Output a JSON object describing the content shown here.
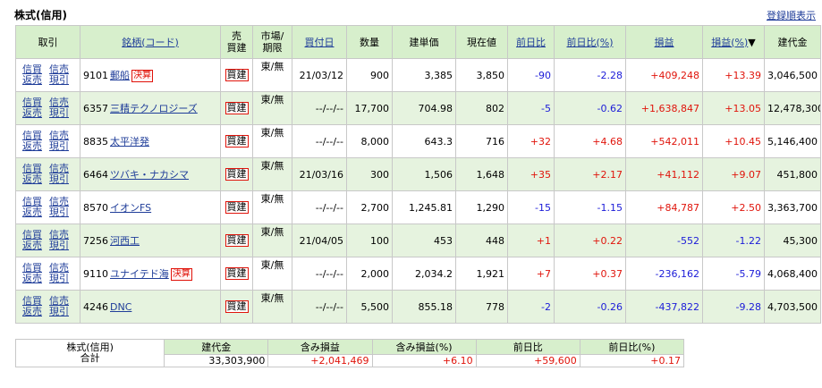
{
  "header": {
    "title": "株式(信用)",
    "sort_link": "登録順表示"
  },
  "columns": {
    "trade": "取引",
    "name_code": "銘柄(コード)",
    "sell_buy": "売\n買建",
    "market_term": "市場/\n期限",
    "date": "買付日",
    "qty": "数量",
    "price": "建単価",
    "current": "現在値",
    "day_change": "前日比",
    "day_change_pct": "前日比(%)",
    "pnl": "損益",
    "pnl_pct": "損益(%)",
    "sort_arrow": "▼",
    "amount": "建代金"
  },
  "actions": {
    "a1": "信買",
    "a2": "信売",
    "a3": "返売",
    "a4": "現引"
  },
  "rows": [
    {
      "code": "9101",
      "name": "郵船",
      "badge": "決算",
      "side": "買建",
      "market": "東/無",
      "date": "21/03/12",
      "qty": "900",
      "price": "3,385",
      "current": "3,850",
      "chg": "-90",
      "chg_pct": "-2.28",
      "pnl": "+409,248",
      "pnl_pct": "+13.39",
      "amount": "3,046,500"
    },
    {
      "code": "6357",
      "name": "三精テクノロジーズ",
      "badge": "",
      "side": "買建",
      "market": "東/無",
      "date": "--/--/--",
      "qty": "17,700",
      "price": "704.98",
      "current": "802",
      "chg": "-5",
      "chg_pct": "-0.62",
      "pnl": "+1,638,847",
      "pnl_pct": "+13.05",
      "amount": "12,478,300"
    },
    {
      "code": "8835",
      "name": "太平洋発",
      "badge": "",
      "side": "買建",
      "market": "東/無",
      "date": "--/--/--",
      "qty": "8,000",
      "price": "643.3",
      "current": "716",
      "chg": "+32",
      "chg_pct": "+4.68",
      "pnl": "+542,011",
      "pnl_pct": "+10.45",
      "amount": "5,146,400"
    },
    {
      "code": "6464",
      "name": "ツバキ・ナカシマ",
      "badge": "",
      "side": "買建",
      "market": "東/無",
      "date": "21/03/16",
      "qty": "300",
      "price": "1,506",
      "current": "1,648",
      "chg": "+35",
      "chg_pct": "+2.17",
      "pnl": "+41,112",
      "pnl_pct": "+9.07",
      "amount": "451,800"
    },
    {
      "code": "8570",
      "name": "イオンFS",
      "badge": "",
      "side": "買建",
      "market": "東/無",
      "date": "--/--/--",
      "qty": "2,700",
      "price": "1,245.81",
      "current": "1,290",
      "chg": "-15",
      "chg_pct": "-1.15",
      "pnl": "+84,787",
      "pnl_pct": "+2.50",
      "amount": "3,363,700"
    },
    {
      "code": "7256",
      "name": "河西工",
      "badge": "",
      "side": "買建",
      "market": "東/無",
      "date": "21/04/05",
      "qty": "100",
      "price": "453",
      "current": "448",
      "chg": "+1",
      "chg_pct": "+0.22",
      "pnl": "-552",
      "pnl_pct": "-1.22",
      "amount": "45,300"
    },
    {
      "code": "9110",
      "name": "ユナイテド海",
      "badge": "決算",
      "side": "買建",
      "market": "東/無",
      "date": "--/--/--",
      "qty": "2,000",
      "price": "2,034.2",
      "current": "1,921",
      "chg": "+7",
      "chg_pct": "+0.37",
      "pnl": "-236,162",
      "pnl_pct": "-5.79",
      "amount": "4,068,400"
    },
    {
      "code": "4246",
      "name": "DNC",
      "badge": "",
      "side": "買建",
      "market": "東/無",
      "date": "--/--/--",
      "qty": "5,500",
      "price": "855.18",
      "current": "778",
      "chg": "-2",
      "chg_pct": "-0.26",
      "pnl": "-437,822",
      "pnl_pct": "-9.28",
      "amount": "4,703,500"
    }
  ],
  "summary": {
    "label1": "株式(信用)",
    "label2": "合計",
    "headers": [
      "建代金",
      "含み損益",
      "含み損益(%)",
      "前日比",
      "前日比(%)"
    ],
    "values": [
      "33,303,900",
      "+2,041,469",
      "+6.10",
      "+59,600",
      "+0.17"
    ]
  },
  "colors": {
    "header_bg": "#d7efcc",
    "alt_row_bg": "#e6f3df",
    "link": "#1f3d99",
    "positive": "#e0140b",
    "negative": "#1b1bd8"
  }
}
